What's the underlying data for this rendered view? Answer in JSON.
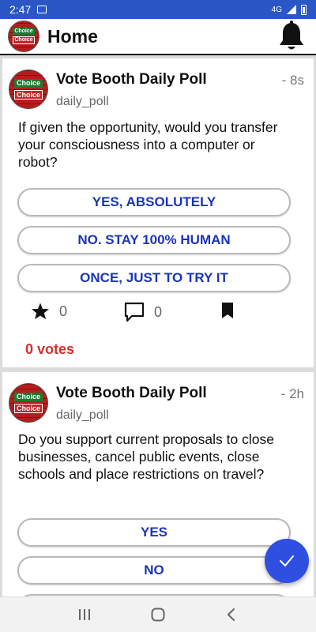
{
  "status_bar": {
    "time": "2:47",
    "network": "4G"
  },
  "header": {
    "title": "Home"
  },
  "logo": {
    "line1": "Choice",
    "line2": "Choice"
  },
  "polls": [
    {
      "name": "Vote Booth Daily Poll",
      "handle": "daily_poll",
      "time": "- 8s",
      "question": "If given the opportunity, would you transfer your consciousness into a computer or robot?",
      "options": [
        "YES, ABSOLUTELY",
        "NO. STAY 100% HUMAN",
        "ONCE, JUST TO TRY IT"
      ],
      "favorites": "0",
      "comments": "0",
      "votes": "0 votes"
    },
    {
      "name": "Vote Booth Daily Poll",
      "handle": "daily_poll",
      "time": "- 2h",
      "question": "Do you support current proposals to close businesses, cancel public events, close schools and place restrictions on travel?",
      "options": [
        "YES",
        "NO"
      ]
    }
  ],
  "colors": {
    "status_bar": "#2a56c6",
    "option_text": "#1a35b8",
    "votes": "#d32f2f",
    "fab": "#2e4fe0"
  },
  "icons": {
    "bell": "bell-icon",
    "star": "star-icon",
    "comment": "comment-icon",
    "bookmark": "bookmark-icon",
    "fab": "check-icon"
  }
}
